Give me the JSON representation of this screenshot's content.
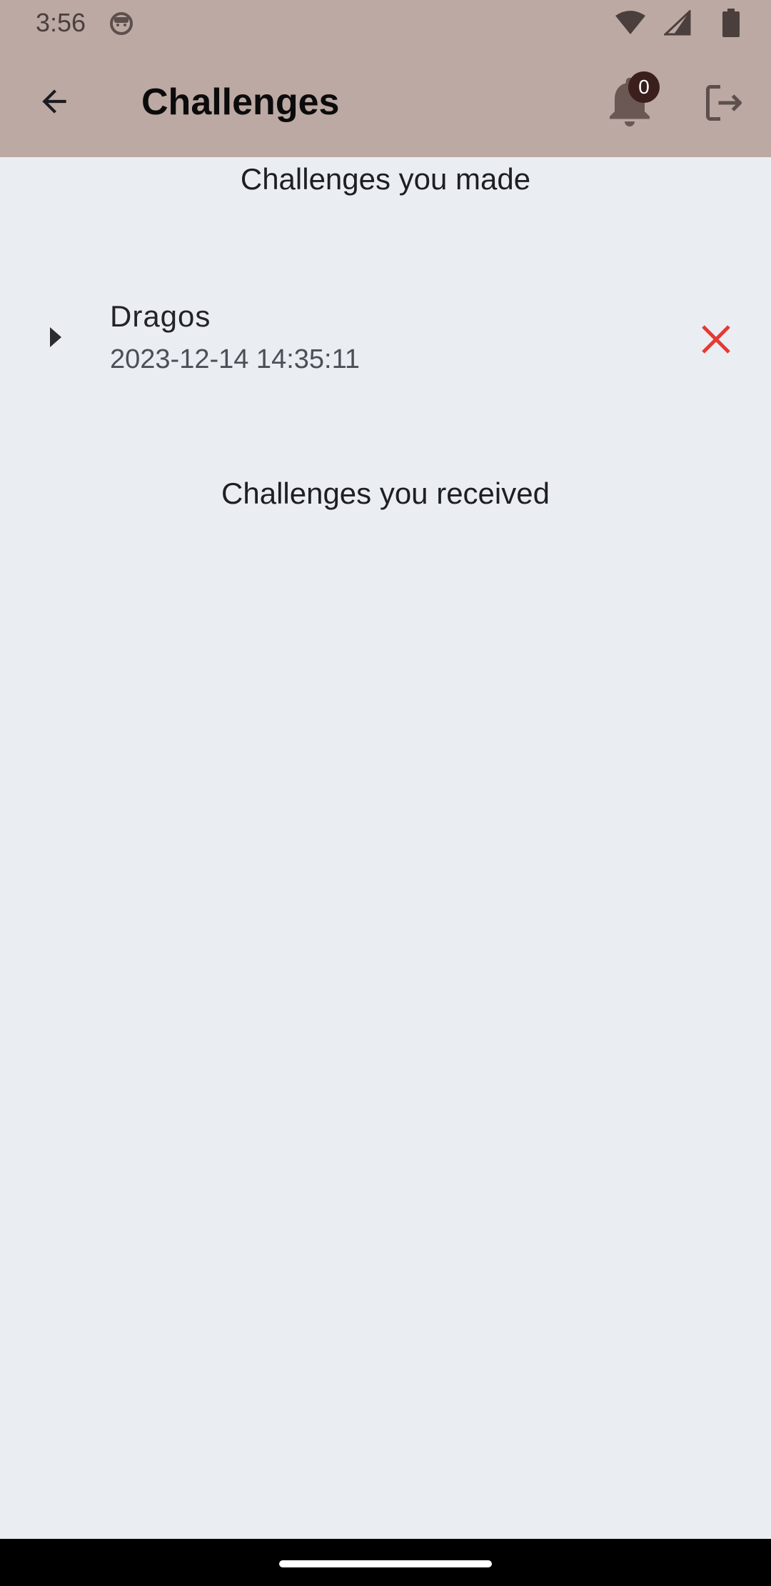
{
  "status_bar": {
    "time": "3:56"
  },
  "app_bar": {
    "title": "Challenges",
    "notification_count": "0"
  },
  "sections": {
    "made_title": "Challenges you made",
    "received_title": "Challenges you received"
  },
  "challenges_made": [
    {
      "name": "Dragos",
      "date": "2023-12-14 14:35:11"
    }
  ],
  "icons": {
    "back": "arrow-back-icon",
    "notifications": "bell-icon",
    "logout": "logout-icon",
    "expand": "triangle-right-icon",
    "delete": "close-icon"
  },
  "colors": {
    "app_bar": "#bca9a4",
    "background": "#eaedf1",
    "delete": "#e53935",
    "badge": "#3a1f1d"
  }
}
